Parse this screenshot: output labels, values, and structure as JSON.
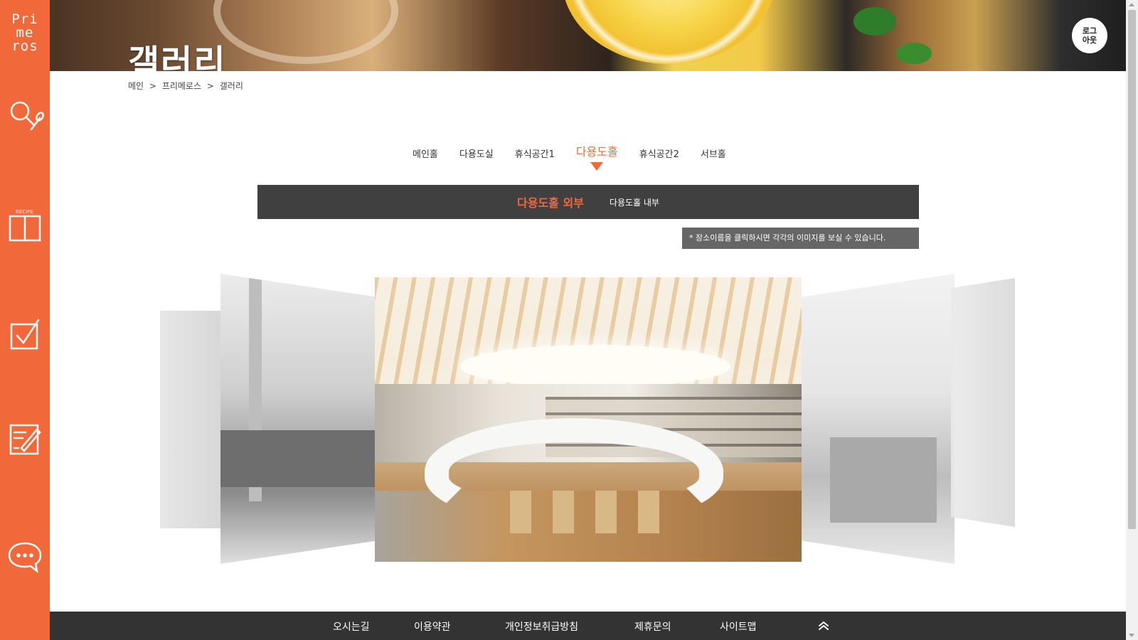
{
  "sidebar": {
    "logo_lines": [
      "Pri",
      "me",
      "ros"
    ],
    "icons": [
      "search-spoon-icon",
      "recipe-book-icon",
      "checklist-icon",
      "write-icon",
      "chat-icon"
    ],
    "accent": "#f1693b"
  },
  "header": {
    "title": "갤러리",
    "logout_line1": "로그",
    "logout_line2": "아웃"
  },
  "breadcrumb": [
    "메인",
    "프리메로스",
    "갤러리"
  ],
  "breadcrumb_sep": ">",
  "tabs": [
    {
      "label": "메인홀",
      "active": false
    },
    {
      "label": "다용도실",
      "active": false
    },
    {
      "label": "휴식공간1",
      "active": false
    },
    {
      "label": "다용도홀",
      "active": true
    },
    {
      "label": "휴식공간2",
      "active": false
    },
    {
      "label": "서브홀",
      "active": false
    }
  ],
  "subtabs": [
    {
      "label": "다용도홀 외부",
      "active": true
    },
    {
      "label": "다용도홀 내부",
      "active": false
    }
  ],
  "notice": "* 장소이름을 클릭하시면 각각의 이미지를 보실 수 있습니다.",
  "footer": {
    "links": [
      "오시는길",
      "이용약관",
      "개인정보취급방침",
      "제휴문의",
      "사이트맵"
    ]
  }
}
